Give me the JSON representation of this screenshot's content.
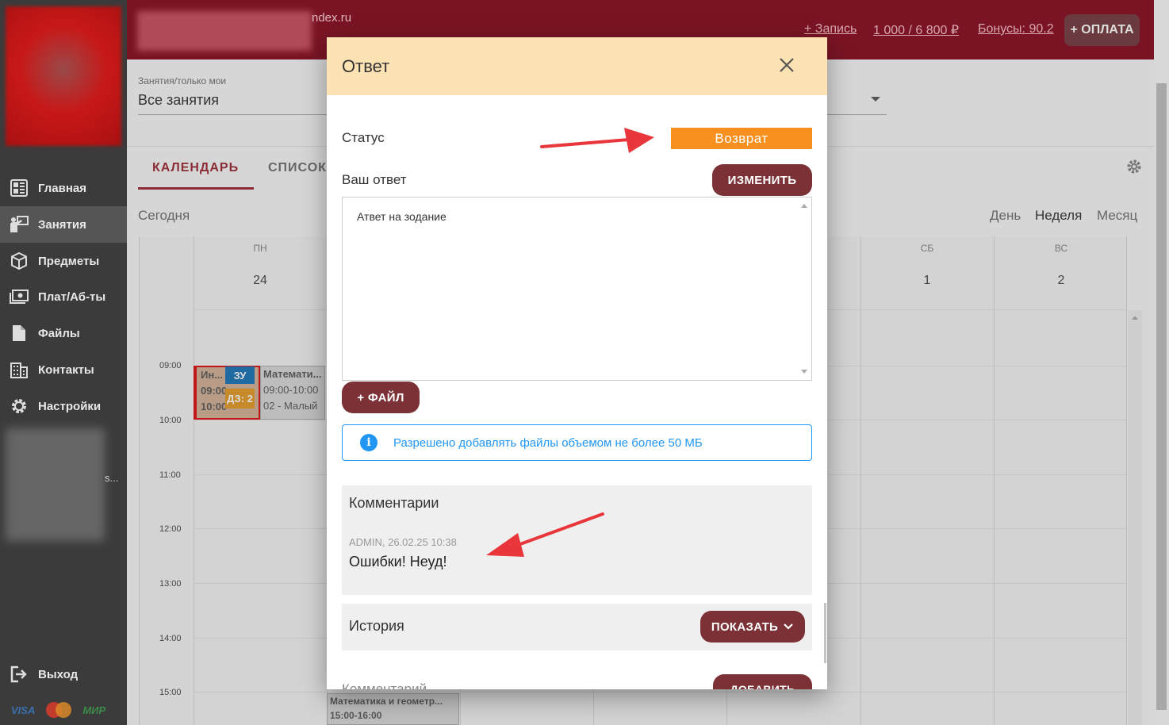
{
  "colors": {
    "brand": "#7a1424",
    "accent": "#8a2d35",
    "status_returned": "#f7901e",
    "info": "#2196f3"
  },
  "sidebar": {
    "items": [
      {
        "label": "Главная",
        "icon": "dashboard-icon"
      },
      {
        "label": "Занятия",
        "icon": "teacher-icon"
      },
      {
        "label": "Предметы",
        "icon": "cube-icon"
      },
      {
        "label": "Плат/Аб-ты",
        "icon": "money-icon"
      },
      {
        "label": "Файлы",
        "icon": "file-icon"
      },
      {
        "label": "Контакты",
        "icon": "building-icon"
      },
      {
        "label": "Настройки",
        "icon": "gear-icon"
      }
    ],
    "user_subtext": "s...",
    "logout": "Выход",
    "payment_logos": [
      "VISA",
      "mastercard",
      "МИР"
    ]
  },
  "topbar": {
    "domain": "ndex.ru",
    "record_link": "+ Запись",
    "balance": "1 000 / 6 800 ₽",
    "bonuses": "Бонусы: 90.2",
    "pay_button": "+ ОПЛАТА"
  },
  "filter": {
    "label": "Занятия/только мои",
    "value": "Все занятия"
  },
  "tabs": {
    "calendar": "КАЛЕНДАРЬ",
    "list": "СПИСОК"
  },
  "calendar": {
    "today": "Сегодня",
    "views": {
      "day": "День",
      "week": "Неделя",
      "month": "Месяц"
    },
    "days": [
      {
        "name": "ПН",
        "num": "24"
      },
      {
        "name": "СБ",
        "num": "1"
      },
      {
        "name": "ВС",
        "num": "2"
      }
    ],
    "times": [
      "09:00",
      "10:00",
      "11:00",
      "12:00",
      "13:00",
      "14:00",
      "15:00"
    ],
    "events": [
      {
        "title": "Ин...",
        "time1": "09:00",
        "time2": "10:00",
        "badge1": "ЗУ",
        "badge2": "ДЗ: 2"
      },
      {
        "title": "Математи...",
        "time": "09:00-10:00",
        "room": "02 - Малый"
      },
      {
        "title": "Математика и геометр...",
        "time": "15:00-16:00"
      }
    ]
  },
  "modal": {
    "title": "Ответ",
    "status_label": "Статус",
    "status_value": "Возврат",
    "answer_label": "Ваш ответ",
    "edit_button": "ИЗМЕНИТЬ",
    "answer_text": "Атвет на зодание",
    "add_file_button": "+ ФАЙЛ",
    "info_text": "Разрешено добавлять файлы объемом не более 50 МБ",
    "comments_title": "Комментарии",
    "comment_meta": "ADMIN, 26.02.25 10:38",
    "comment_text": "Ошибки! Неуд!",
    "history_label": "История",
    "show_button": "ПОКАЗАТЬ",
    "comment_field_partial": "Комментарий",
    "add_button_partial": "ДОБАВИТЬ"
  }
}
